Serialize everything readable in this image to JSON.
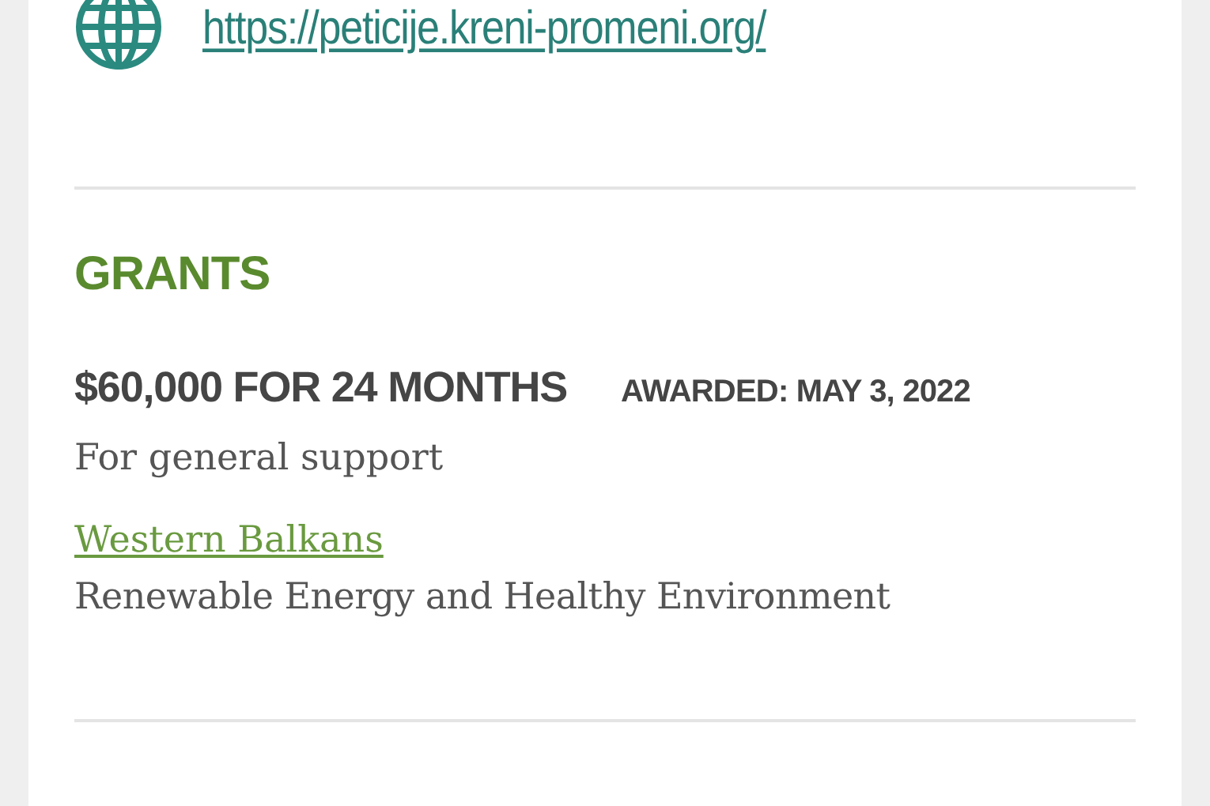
{
  "website": {
    "url": "https://peticije.kreni-promeni.org/"
  },
  "grants": {
    "heading": "GRANTS",
    "items": [
      {
        "amount": "$60,000 FOR 24 MONTHS",
        "awarded": "AWARDED: MAY 3, 2022",
        "purpose": "For general support",
        "region": "Western Balkans",
        "program": "Renewable Energy and Healthy Environment"
      }
    ]
  }
}
